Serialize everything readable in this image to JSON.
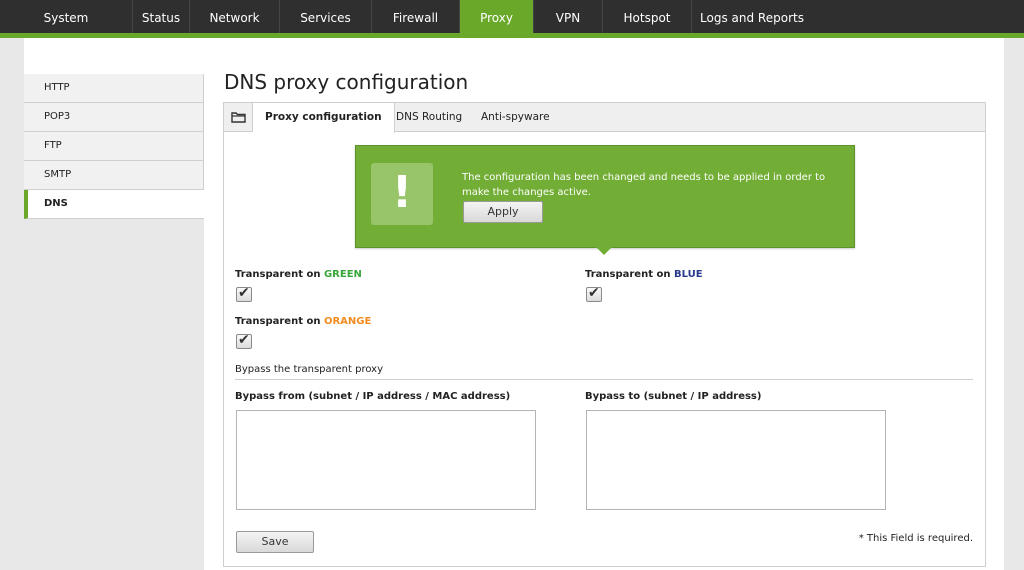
{
  "topnav": {
    "items": [
      {
        "label": "System",
        "active": false
      },
      {
        "label": "Status",
        "active": false
      },
      {
        "label": "Network",
        "active": false
      },
      {
        "label": "Services",
        "active": false
      },
      {
        "label": "Firewall",
        "active": false
      },
      {
        "label": "Proxy",
        "active": true
      },
      {
        "label": "VPN",
        "active": false
      },
      {
        "label": "Hotspot",
        "active": false
      },
      {
        "label": "Logs and Reports",
        "active": false
      }
    ]
  },
  "sidebar": {
    "items": [
      {
        "label": "HTTP",
        "active": false
      },
      {
        "label": "POP3",
        "active": false
      },
      {
        "label": "FTP",
        "active": false
      },
      {
        "label": "SMTP",
        "active": false
      },
      {
        "label": "DNS",
        "active": true
      }
    ]
  },
  "page": {
    "title": "DNS proxy configuration"
  },
  "tabs": {
    "icon": "folder-icon",
    "items": [
      {
        "label": "Proxy configuration",
        "active": true
      },
      {
        "label": "DNS Routing",
        "active": false
      },
      {
        "label": "Anti-spyware",
        "active": false
      }
    ]
  },
  "notice": {
    "icon": "exclamation-icon",
    "symbol": "!",
    "message": "The configuration has been changed and needs to be applied in order to make the changes active.",
    "apply_label": "Apply"
  },
  "form": {
    "transparent_prefix": "Transparent on",
    "green_zone": "GREEN",
    "blue_zone": "BLUE",
    "orange_zone": "ORANGE",
    "green_checked": true,
    "blue_checked": true,
    "orange_checked": true,
    "bypass_section_title": "Bypass the transparent proxy",
    "bypass_from_label": "Bypass from (subnet / IP address / MAC address)",
    "bypass_from_value": "",
    "bypass_to_label": "Bypass to (subnet / IP address)",
    "bypass_to_value": "",
    "save_label": "Save",
    "required_note": "* This Field is required."
  },
  "colors": {
    "accent": "#6aa829",
    "notice_bg": "#72ad35",
    "green_zone": "#39a639",
    "blue_zone": "#2a3a8c",
    "orange_zone": "#f28c1e"
  }
}
